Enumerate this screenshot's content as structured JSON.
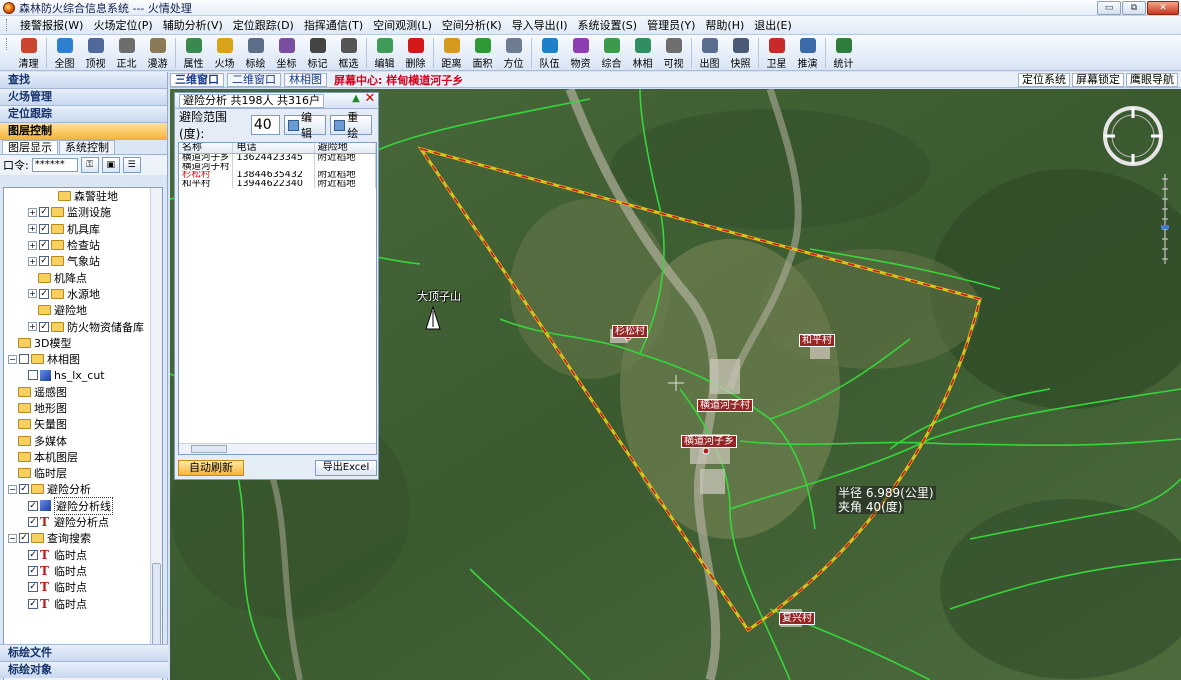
{
  "window": {
    "title": "森林防火综合信息系统 --- 火情处理",
    "buttons": [
      "▭",
      "⧉",
      "✕"
    ]
  },
  "menu": [
    "接警报报(W)",
    "火场定位(P)",
    "辅助分析(V)",
    "定位跟踪(D)",
    "指挥通信(T)",
    "空间观测(L)",
    "空间分析(K)",
    "导入导出(I)",
    "系统设置(S)",
    "管理员(Y)",
    "帮助(H)",
    "退出(E)"
  ],
  "toolbar": [
    {
      "label": "清理",
      "icon": "broom-icon",
      "color": "#c9452e"
    },
    {
      "label": "全图",
      "icon": "globe-icon",
      "color": "#2e7fd0"
    },
    {
      "label": "顶视",
      "icon": "top-view-icon",
      "color": "#4f6a9a"
    },
    {
      "label": "正北",
      "icon": "north-arrow-icon",
      "color": "#6d6d6d"
    },
    {
      "label": "漫游",
      "icon": "pan-hand-icon",
      "color": "#8a7a55"
    },
    {
      "label": "属性",
      "icon": "attribute-icon",
      "color": "#3a8a4f"
    },
    {
      "label": "火场",
      "icon": "fire-scene-icon",
      "color": "#d7a319"
    },
    {
      "label": "标绘",
      "icon": "plot-pen-icon",
      "color": "#5c6f8a"
    },
    {
      "label": "坐标",
      "icon": "coordinate-icon",
      "color": "#7a4ea0"
    },
    {
      "label": "标记",
      "icon": "marker-icon",
      "color": "#444444"
    },
    {
      "label": "框选",
      "icon": "box-select-icon",
      "color": "#555555"
    },
    {
      "label": "编辑",
      "icon": "edit-icon",
      "color": "#3f9c58"
    },
    {
      "label": "删除",
      "icon": "delete-icon",
      "color": "#d21818"
    },
    {
      "label": "距离",
      "icon": "distance-icon",
      "color": "#d49a1e"
    },
    {
      "label": "面积",
      "icon": "area-icon",
      "color": "#2f9a35"
    },
    {
      "label": "方位",
      "icon": "bearing-icon",
      "color": "#6e7c91"
    },
    {
      "label": "队伍",
      "icon": "team-icon",
      "color": "#1f7fc8"
    },
    {
      "label": "物资",
      "icon": "supplies-icon",
      "color": "#8b3fb0"
    },
    {
      "label": "综合",
      "icon": "composite-icon",
      "color": "#3b9a4b"
    },
    {
      "label": "林相",
      "icon": "forest-icon",
      "color": "#2f8f60"
    },
    {
      "label": "可视",
      "icon": "visibility-icon",
      "color": "#6e6e6e"
    },
    {
      "label": "出图",
      "icon": "export-map-icon",
      "color": "#5a6f90"
    },
    {
      "label": "快照",
      "icon": "snapshot-icon",
      "color": "#4a5a74"
    },
    {
      "label": "卫星",
      "icon": "satellite-icon",
      "color": "#c72a2a"
    },
    {
      "label": "推演",
      "icon": "simulate-icon",
      "color": "#3a6aa8"
    },
    {
      "label": "统计",
      "icon": "statistics-icon",
      "color": "#2f7d3a"
    }
  ],
  "leftnav": {
    "sections_top": [
      "查找",
      "火场管理",
      "定位跟踪",
      "图层控制"
    ],
    "active_section": "图层控制",
    "subtabs": [
      "图层显示",
      "系统控制"
    ],
    "password_label": "口令:",
    "password_value": "******",
    "tree": [
      {
        "indent": 5,
        "exp": "",
        "cb": "",
        "icon": "folder",
        "label": "森警驻地"
      },
      {
        "indent": 2,
        "exp": "+",
        "cb": "✓",
        "icon": "folder",
        "label": "监测设施"
      },
      {
        "indent": 2,
        "exp": "+",
        "cb": "✓",
        "icon": "folder",
        "label": "机具库"
      },
      {
        "indent": 2,
        "exp": "+",
        "cb": "✓",
        "icon": "folder",
        "label": "检查站"
      },
      {
        "indent": 2,
        "exp": "+",
        "cb": "✓",
        "icon": "folder",
        "label": "气象站"
      },
      {
        "indent": 3,
        "exp": "",
        "cb": "",
        "icon": "folder",
        "label": "机降点"
      },
      {
        "indent": 2,
        "exp": "+",
        "cb": "✓",
        "icon": "folder",
        "label": "水源地"
      },
      {
        "indent": 3,
        "exp": "",
        "cb": "",
        "icon": "folder",
        "label": "避险地"
      },
      {
        "indent": 2,
        "exp": "+",
        "cb": "✓",
        "icon": "folder",
        "label": "防火物资储备库"
      },
      {
        "indent": 1,
        "exp": "",
        "cb": "",
        "icon": "folder",
        "label": "3D模型"
      },
      {
        "indent": 0,
        "exp": "−",
        "cb": "☐",
        "icon": "folder",
        "label": "林相图"
      },
      {
        "indent": 2,
        "exp": "",
        "cb": "☐",
        "icon": "cube",
        "label": "hs_lx_cut"
      },
      {
        "indent": 1,
        "exp": "",
        "cb": "",
        "icon": "folder",
        "label": "遥感图"
      },
      {
        "indent": 1,
        "exp": "",
        "cb": "",
        "icon": "folder",
        "label": "地形图"
      },
      {
        "indent": 1,
        "exp": "",
        "cb": "",
        "icon": "folder",
        "label": "矢量图"
      },
      {
        "indent": 1,
        "exp": "",
        "cb": "",
        "icon": "folder",
        "label": "多媒体"
      },
      {
        "indent": 1,
        "exp": "",
        "cb": "",
        "icon": "folder",
        "label": "本机图层"
      },
      {
        "indent": 1,
        "exp": "",
        "cb": "",
        "icon": "folder",
        "label": "临时层"
      },
      {
        "indent": 0,
        "exp": "−",
        "cb": "✓",
        "icon": "folder",
        "label": "避险分析"
      },
      {
        "indent": 2,
        "exp": "",
        "cb": "✓",
        "icon": "cube",
        "label": "避险分析线",
        "boxed": true
      },
      {
        "indent": 2,
        "exp": "",
        "cb": "✓",
        "icon": "T",
        "label": "避险分析点"
      },
      {
        "indent": 0,
        "exp": "−",
        "cb": "✓",
        "icon": "folder",
        "label": "查询搜索"
      },
      {
        "indent": 2,
        "exp": "",
        "cb": "✓",
        "icon": "T",
        "label": "临时点"
      },
      {
        "indent": 2,
        "exp": "",
        "cb": "✓",
        "icon": "T",
        "label": "临时点"
      },
      {
        "indent": 2,
        "exp": "",
        "cb": "✓",
        "icon": "T",
        "label": "临时点"
      },
      {
        "indent": 2,
        "exp": "",
        "cb": "✓",
        "icon": "T",
        "label": "临时点"
      }
    ],
    "sections_bottom": [
      "标绘文件",
      "标绘对象"
    ]
  },
  "maptabs": {
    "tabs": [
      "三维窗口",
      "二维窗口",
      "林相图"
    ],
    "active": "三维窗口",
    "center_label": "屏幕中心: 样甸横道河子乡",
    "right_buttons": [
      "定位系统",
      "屏幕锁定",
      "鹰眼导航"
    ]
  },
  "panel": {
    "title": "避险分析 共198人 共316户",
    "range_label": "避险范围(度):",
    "range_value": "40",
    "edit_label": "编辑",
    "redraw_label": "重绘",
    "columns": [
      "名称",
      "电话",
      "避险地"
    ],
    "rows": [
      {
        "name": "横道河子乡",
        "phone": "13624423345",
        "refuge": "附近稻地",
        "highlight": false
      },
      {
        "name": "横道河子村",
        "phone": "",
        "refuge": "",
        "highlight": false
      },
      {
        "name": "杉松村",
        "phone": "13844635432",
        "refuge": "附近稻地",
        "highlight": true
      },
      {
        "name": "和平村",
        "phone": "13944622340",
        "refuge": "附近稻地",
        "highlight": false
      }
    ],
    "auto_refresh_label": "自动刷新",
    "export_label": "导出Excel"
  },
  "map": {
    "labels": {
      "mountain": "大顶子山",
      "shansong": "杉松村",
      "heping": "和平村",
      "hengdao_village": "横道河子村",
      "hengdao_township": "横道河子乡",
      "fuxing": "复兴村"
    },
    "radius_text": "半径 6.989(公里)",
    "angle_text": "夹角 40(度)",
    "sector_color": "#e8d21a",
    "sector_dash_color": "#d0161a"
  }
}
